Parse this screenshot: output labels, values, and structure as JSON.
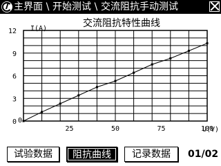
{
  "titlebar": {
    "breadcrumb": [
      "主界面",
      "开始测试",
      "交流阻抗手动测试"
    ]
  },
  "chart_data": {
    "type": "line",
    "title": "交流阻抗特性曲线",
    "xlabel": "U(V)",
    "ylabel": "I(A)",
    "xlim": [
      0,
      100
    ],
    "ylim": [
      0,
      12
    ],
    "xticks": [
      0,
      25,
      50,
      75,
      100
    ],
    "yticks": [
      0,
      3,
      6,
      9,
      12
    ],
    "grid": true,
    "x": [
      0,
      10,
      20,
      30,
      40,
      50,
      60,
      70,
      80,
      90,
      100
    ],
    "y": [
      0,
      1.2,
      2.3,
      3.4,
      4.5,
      5.3,
      6.4,
      7.5,
      8.3,
      9.3,
      10.3
    ]
  },
  "buttons": {
    "test_data": "试验数据",
    "impedance_curve": "阻抗曲线",
    "record_data": "记录数据"
  },
  "pager": {
    "text": "01/02"
  }
}
